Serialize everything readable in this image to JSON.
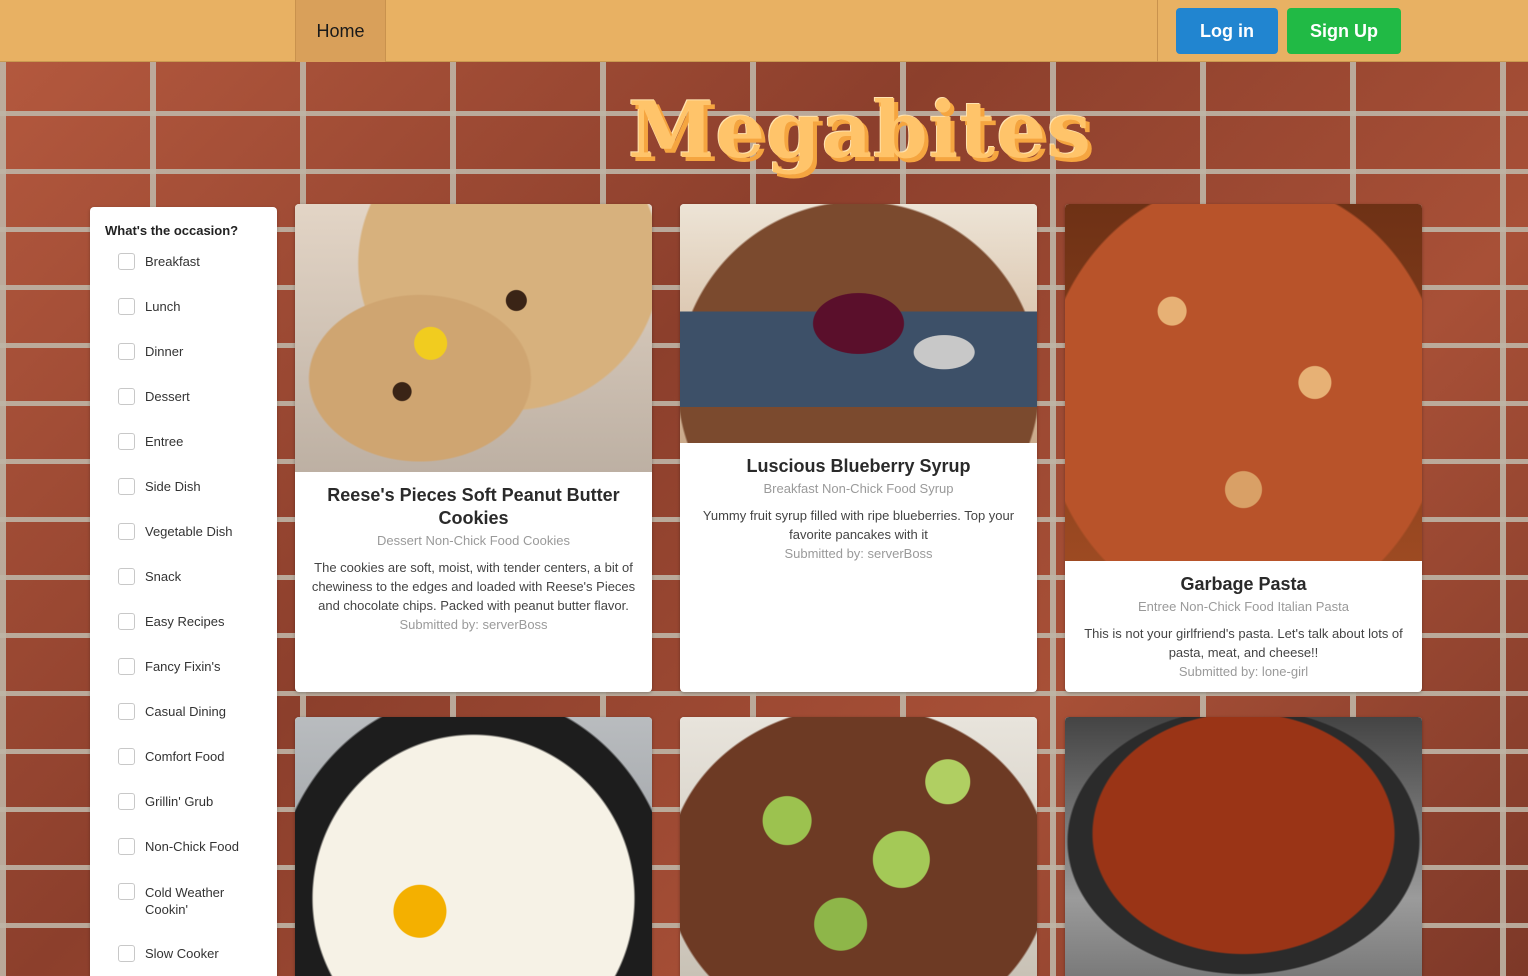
{
  "nav": {
    "home_label": "Home",
    "login_label": "Log in",
    "signup_label": "Sign Up"
  },
  "logo": {
    "text": "Megabites"
  },
  "sidebar": {
    "title": "What's the occasion?",
    "items": [
      {
        "label": "Breakfast"
      },
      {
        "label": "Lunch"
      },
      {
        "label": "Dinner"
      },
      {
        "label": "Dessert"
      },
      {
        "label": "Entree"
      },
      {
        "label": "Side Dish"
      },
      {
        "label": "Vegetable Dish"
      },
      {
        "label": "Snack"
      },
      {
        "label": "Easy Recipes"
      },
      {
        "label": "Fancy Fixin's"
      },
      {
        "label": "Casual Dining"
      },
      {
        "label": "Comfort Food"
      },
      {
        "label": "Grillin' Grub"
      },
      {
        "label": "Non-Chick Food"
      },
      {
        "label": "Cold Weather Cookin'"
      },
      {
        "label": "Slow Cooker"
      }
    ]
  },
  "recipes": [
    {
      "title": "Reese's Pieces Soft Peanut Butter Cookies",
      "tags": "Dessert Non-Chick Food Cookies",
      "description": "The cookies are soft, moist, with tender centers, a bit of chewiness to the edges and loaded with Reese's Pieces and chocolate chips. Packed with peanut butter flavor.",
      "submitted": "Submitted by: serverBoss"
    },
    {
      "title": "Luscious Blueberry Syrup",
      "tags": "Breakfast Non-Chick Food Syrup",
      "description": "Yummy fruit syrup filled with ripe blueberries. Top your favorite pancakes with it",
      "submitted": "Submitted by: serverBoss"
    },
    {
      "title": "Garbage Pasta",
      "tags": "Entree Non-Chick Food Italian Pasta",
      "description": "This is not your girlfriend's pasta. Let's talk about lots of pasta, meat, and cheese!!",
      "submitted": "Submitted by: lone-girl"
    }
  ]
}
